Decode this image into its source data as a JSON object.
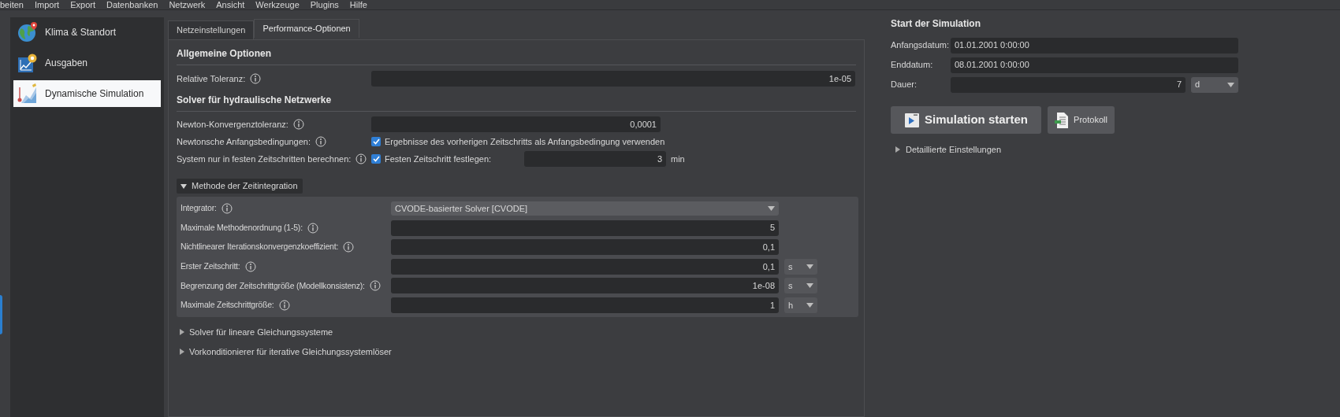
{
  "menu": [
    {
      "label": "beiten"
    },
    {
      "label": "Import"
    },
    {
      "label": "Export"
    },
    {
      "label": "Datenbanken"
    },
    {
      "label": "Netzwerk"
    },
    {
      "label": "Ansicht"
    },
    {
      "label": "Werkzeuge"
    },
    {
      "label": "Plugins"
    },
    {
      "label": "Hilfe"
    }
  ],
  "sidebar": {
    "items": [
      {
        "label": "Klima & Standort",
        "kind": "globe",
        "selected": false
      },
      {
        "label": "Ausgaben",
        "kind": "chart",
        "selected": false
      },
      {
        "label": "Dynamische Simulation",
        "kind": "simulation",
        "selected": true
      }
    ]
  },
  "tabs": [
    {
      "label": "Netzeinstellungen",
      "selected": false
    },
    {
      "label": "Performance-Optionen",
      "selected": true
    }
  ],
  "general": {
    "title": "Allgemeine Optionen",
    "rows": [
      {
        "kind": "field",
        "label": "Relative Toleranz:",
        "value": "1e-05"
      }
    ]
  },
  "hydraulic": {
    "title": "Solver für hydraulische Netzwerke",
    "rows": [
      {
        "kind": "field",
        "label": "Newton-Konvergenztoleranz:",
        "value": "0,0001"
      },
      {
        "kind": "checkbox",
        "label": "Newtonsche Anfangsbedingungen:",
        "checked": true,
        "text": "Ergebnisse des vorherigen Zeitschritts als Anfangsbedingung verwenden"
      },
      {
        "kind": "checkbox_field",
        "label": "System nur in festen Zeitschritten berechnen:",
        "checked": true,
        "text": "Festen Zeitschritt festlegen:",
        "value": "3",
        "unit": "min"
      }
    ]
  },
  "time_integration": {
    "title": "Methode der Zeitintegration",
    "expanded": true,
    "rows": [
      {
        "kind": "dropdown",
        "label": "Integrator:",
        "value": "CVODE-basierter Solver [CVODE]"
      },
      {
        "kind": "field",
        "label": "Maximale Methodenordnung (1-5):",
        "value": "5"
      },
      {
        "kind": "field",
        "label": "Nichtlinearer Iterationskonvergenzkoeffizient:",
        "value": "0,1"
      },
      {
        "kind": "field",
        "label": "Erster Zeitschritt:",
        "value": "0,1",
        "unit": "s"
      },
      {
        "kind": "field",
        "label": "Begrenzung der Zeitschrittgröße (Modellkonsistenz):",
        "value": "1e-08",
        "unit": "s"
      },
      {
        "kind": "field",
        "label": "Maximale Zeitschrittgröße:",
        "value": "1",
        "unit": "h"
      }
    ]
  },
  "collapsed_sections": [
    {
      "title": "Solver für lineare Gleichungssysteme",
      "expanded": false
    },
    {
      "title": "Vorkonditionierer für iterative Gleichungssystemlöser",
      "expanded": false
    }
  ],
  "simulation": {
    "title": "Start der Simulation",
    "rows": [
      {
        "label": "Anfangsdatum:",
        "value": "01.01.2001  0:00:00"
      },
      {
        "label": "Enddatum:",
        "value": "08.01.2001  0:00:00"
      },
      {
        "label": "Dauer:",
        "value": "7",
        "unit": "d"
      }
    ],
    "buttons": [
      {
        "label": "Simulation starten",
        "kind": "start"
      },
      {
        "label": "Protokoll",
        "kind": "log"
      }
    ],
    "details": {
      "title": "Detaillierte Einstellungen",
      "expanded": false
    }
  }
}
